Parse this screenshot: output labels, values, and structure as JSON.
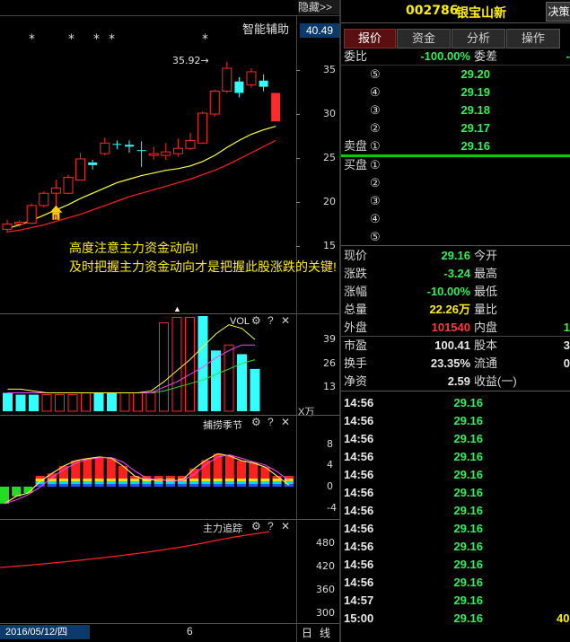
{
  "header": {
    "hide_button": "隐藏>>",
    "stock_code": "002786",
    "stock_name": "银宝山新",
    "decision_button": "决策",
    "assist_label": "智能辅助",
    "cursor_price": "40.49"
  },
  "tabs": [
    "报价",
    "资金",
    "分析",
    "操作"
  ],
  "main_chart": {
    "markers": [
      "*",
      "*",
      "*",
      "*",
      "*"
    ],
    "high_annotation": "35.92",
    "y_ticks": [
      "35",
      "30",
      "25",
      "20",
      "15"
    ],
    "notice_line1": "高度注意主力资金动向!",
    "notice_line2": "及时把握主力资金动向才是把握此股涨跌的关键!",
    "candles": [
      {
        "o": 16.9,
        "c": 17.5,
        "h": 18.0,
        "l": 16.5,
        "up": true
      },
      {
        "o": 17.5,
        "c": 17.7,
        "h": 17.9,
        "l": 17.2,
        "up": true
      },
      {
        "o": 17.6,
        "c": 19.6,
        "h": 19.8,
        "l": 17.5,
        "up": true
      },
      {
        "o": 19.6,
        "c": 21.0,
        "h": 21.2,
        "l": 19.4,
        "up": true
      },
      {
        "o": 21.0,
        "c": 21.6,
        "h": 22.5,
        "l": 19.5,
        "up": true
      },
      {
        "o": 21.0,
        "c": 22.8,
        "h": 23.1,
        "l": 20.9,
        "up": true
      },
      {
        "o": 22.5,
        "c": 24.9,
        "h": 25.6,
        "l": 22.5,
        "up": true
      },
      {
        "o": 24.5,
        "c": 24.2,
        "h": 24.8,
        "l": 23.7,
        "up": false
      },
      {
        "o": 25.5,
        "c": 26.7,
        "h": 27.3,
        "l": 25.3,
        "up": true
      },
      {
        "o": 26.6,
        "c": 26.5,
        "h": 27.0,
        "l": 26.0,
        "up": false
      },
      {
        "o": 26.3,
        "c": 26.5,
        "h": 27.0,
        "l": 25.6,
        "up": false
      },
      {
        "o": 25.9,
        "c": 25.9,
        "h": 26.9,
        "l": 24.0,
        "up": false
      },
      {
        "o": 25.3,
        "c": 25.5,
        "h": 26.3,
        "l": 24.8,
        "up": true
      },
      {
        "o": 25.3,
        "c": 25.7,
        "h": 26.7,
        "l": 24.8,
        "up": true
      },
      {
        "o": 25.5,
        "c": 26.1,
        "h": 27.2,
        "l": 25.2,
        "up": true
      },
      {
        "o": 26.1,
        "c": 27.0,
        "h": 27.9,
        "l": 25.9,
        "up": true
      },
      {
        "o": 26.7,
        "c": 30.1,
        "h": 30.3,
        "l": 26.6,
        "up": true
      },
      {
        "o": 30.0,
        "c": 32.6,
        "h": 32.8,
        "l": 29.7,
        "up": true
      },
      {
        "o": 32.6,
        "c": 35.2,
        "h": 35.92,
        "l": 32.4,
        "up": true
      },
      {
        "o": 33.7,
        "c": 32.4,
        "h": 34.2,
        "l": 31.9,
        "up": false
      },
      {
        "o": 33.3,
        "c": 34.8,
        "h": 35.2,
        "l": 33.0,
        "up": true
      },
      {
        "o": 33.8,
        "c": 33.1,
        "h": 34.5,
        "l": 32.6,
        "up": false
      },
      {
        "o": 32.4,
        "c": 29.16,
        "h": 32.4,
        "l": 29.16,
        "up": false
      }
    ],
    "ma_yellow": [
      17.0,
      17.4,
      17.9,
      18.5,
      19.1,
      19.7,
      20.4,
      21.0,
      21.6,
      22.2,
      22.6,
      23.0,
      23.3,
      23.6,
      23.8,
      24.1,
      24.6,
      25.3,
      26.2,
      27.0,
      27.7,
      28.2,
      28.6
    ],
    "ma_red": [
      16.6,
      16.8,
      17.1,
      17.4,
      17.8,
      18.2,
      18.6,
      19.1,
      19.6,
      20.1,
      20.6,
      21.0,
      21.4,
      21.8,
      22.2,
      22.6,
      23.1,
      23.6,
      24.2,
      24.9,
      25.6,
      26.3,
      27.0
    ]
  },
  "vol_panel": {
    "title": "VOL",
    "y_ticks": [
      "39",
      "26",
      "13"
    ],
    "unit": "X万",
    "bars": [
      {
        "v": 10,
        "type": "cyan"
      },
      {
        "v": 9,
        "type": "cyan"
      },
      {
        "v": 9,
        "type": "cyan"
      },
      {
        "v": 9,
        "type": "red"
      },
      {
        "v": 9,
        "type": "red"
      },
      {
        "v": 9,
        "type": "red"
      },
      {
        "v": 10,
        "type": "red"
      },
      {
        "v": 10,
        "type": "cyan"
      },
      {
        "v": 10,
        "type": "cyan"
      },
      {
        "v": 10,
        "type": "red"
      },
      {
        "v": 10,
        "type": "red"
      },
      {
        "v": 10,
        "type": "red"
      },
      {
        "v": 48,
        "type": "red"
      },
      {
        "v": 51,
        "type": "red"
      },
      {
        "v": 51,
        "type": "red"
      },
      {
        "v": 54,
        "type": "cyan"
      },
      {
        "v": 33,
        "type": "cyan"
      },
      {
        "v": 36,
        "type": "red"
      },
      {
        "v": 31,
        "type": "cyan"
      },
      {
        "v": 23,
        "type": "cyan"
      }
    ]
  },
  "season_panel": {
    "title": "捕捞季节",
    "y_ticks": [
      "8",
      "4",
      "0",
      "-4"
    ],
    "bars": [
      -3.2,
      -1.8,
      -1.2,
      1.0,
      2.5,
      3.9,
      4.9,
      5.3,
      5.6,
      5.4,
      3.9,
      2.0,
      1.2,
      1.4,
      1.1,
      1.2,
      3.4,
      5.0,
      6.2,
      5.8,
      4.9,
      4.5,
      3.7,
      2.0,
      0.3
    ]
  },
  "main_track_panel": {
    "title": "主力追踪",
    "y_ticks": [
      "480",
      "420",
      "360",
      "300"
    ]
  },
  "footer": {
    "date": "2016/05/12/四",
    "number": "6",
    "period1": "日",
    "period2": "线"
  },
  "quote": {
    "webi_label": "委比",
    "webi_value": "-100.00%",
    "weicha_label": "委差",
    "sell_label": "卖盘",
    "buy_label": "买盘",
    "sell_rows": [
      {
        "num": "⑤",
        "price": "29.20"
      },
      {
        "num": "④",
        "price": "29.19"
      },
      {
        "num": "③",
        "price": "29.18"
      },
      {
        "num": "②",
        "price": "29.17"
      },
      {
        "num": "①",
        "price": "29.16"
      }
    ],
    "buy_rows": [
      "①",
      "②",
      "③",
      "④",
      "⑤"
    ],
    "stats": [
      {
        "l1": "现价",
        "v1": "29.16",
        "c1": "green",
        "l2": "今开"
      },
      {
        "l1": "涨跌",
        "v1": "-3.24",
        "c1": "green",
        "l2": "最高"
      },
      {
        "l1": "涨幅",
        "v1": "-10.00%",
        "c1": "green",
        "l2": "最低"
      },
      {
        "l1": "总量",
        "v1": "22.26万",
        "c1": "yellow",
        "l2": "量比"
      },
      {
        "l1": "外盘",
        "v1": "101540",
        "c1": "red",
        "l2": "内盘",
        "v2": "1",
        "c2": "green"
      },
      {
        "l1": "市盈",
        "v1": "100.41",
        "c1": "white",
        "l2": "股本",
        "v2": "3",
        "c2": "white"
      },
      {
        "l1": "换手",
        "v1": "23.35%",
        "c1": "white",
        "l2": "流通",
        "v2": "0",
        "c2": "white"
      },
      {
        "l1": "净资",
        "v1": "2.59",
        "c1": "white",
        "l2": "收益(一)"
      }
    ],
    "ticks": [
      {
        "t": "14:56",
        "p": "29.16",
        "v": ""
      },
      {
        "t": "14:56",
        "p": "29.16",
        "v": ""
      },
      {
        "t": "14:56",
        "p": "29.16",
        "v": ""
      },
      {
        "t": "14:56",
        "p": "29.16",
        "v": ""
      },
      {
        "t": "14:56",
        "p": "29.16",
        "v": ""
      },
      {
        "t": "14:56",
        "p": "29.16",
        "v": ""
      },
      {
        "t": "14:56",
        "p": "29.16",
        "v": ""
      },
      {
        "t": "14:56",
        "p": "29.16",
        "v": ""
      },
      {
        "t": "14:56",
        "p": "29.16",
        "v": ""
      },
      {
        "t": "14:56",
        "p": "29.16",
        "v": ""
      },
      {
        "t": "14:56",
        "p": "29.16",
        "v": ""
      },
      {
        "t": "14:57",
        "p": "29.16",
        "v": ""
      },
      {
        "t": "15:00",
        "p": "29.16",
        "v": "40"
      }
    ]
  },
  "colors": {
    "up": "#ff2a2a",
    "down": "#33ffff",
    "ma_yellow": "#ffff33",
    "ma_red": "#ff2020",
    "green": "#33ee55",
    "accent_line": "#00cc00"
  }
}
